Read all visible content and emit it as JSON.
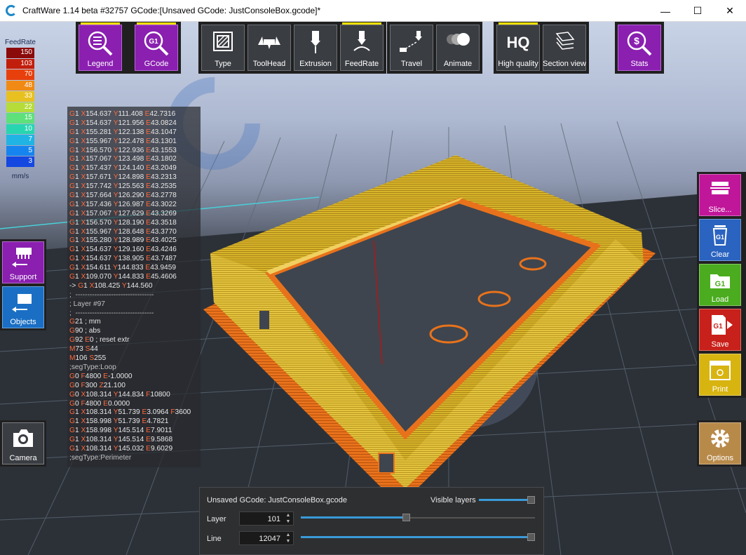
{
  "window": {
    "title": "CraftWare 1.14 beta #32757   GCode:[Unsaved GCode: JustConsoleBox.gcode]*",
    "minimize": "—",
    "maximize": "☐",
    "close": "✕"
  },
  "toolbar": {
    "legend": "Legend",
    "gcode": "GCode",
    "gcode_icon_text": "G1",
    "type": "Type",
    "toolhead": "ToolHead",
    "extrusion": "Extrusion",
    "feedrate": "FeedRate",
    "travel": "Travel",
    "animate": "Animate",
    "high_quality": "High quality",
    "hq_icon_text": "HQ",
    "section_view": "Section view",
    "stats": "Stats"
  },
  "legend": {
    "title": "FeedRate",
    "unit": "mm/s",
    "rows": [
      {
        "value": "150",
        "color": "#8b0a0a"
      },
      {
        "value": "103",
        "color": "#c21e0c"
      },
      {
        "value": "70",
        "color": "#e8400c"
      },
      {
        "value": "48",
        "color": "#f08a14"
      },
      {
        "value": "33",
        "color": "#e8c020"
      },
      {
        "value": "22",
        "color": "#b6dc3a"
      },
      {
        "value": "15",
        "color": "#5ee07a"
      },
      {
        "value": "10",
        "color": "#27d6b0"
      },
      {
        "value": "7",
        "color": "#1fb4e4"
      },
      {
        "value": "5",
        "color": "#1684ee"
      },
      {
        "value": "3",
        "color": "#1448e0"
      }
    ]
  },
  "gcode_lines": [
    "G1 X154.637 Y111.408 E42.7316",
    "G1 X154.637 Y121.956 E43.0824",
    "G1 X155.281 Y122.138 E43.1047",
    "G1 X155.967 Y122.478 E43.1301",
    "G1 X156.570 Y122.936 E43.1553",
    "G1 X157.067 Y123.498 E43.1802",
    "G1 X157.437 Y124.140 E43.2049",
    "G1 X157.671 Y124.898 E43.2313",
    "G1 X157.742 Y125.563 E43.2535",
    "G1 X157.664 Y126.290 E43.2778",
    "G1 X157.436 Y126.987 E43.3022",
    "G1 X157.067 Y127.629 E43.3269",
    "G1 X156.570 Y128.190 E43.3518",
    "G1 X155.967 Y128.648 E43.3770",
    "G1 X155.280 Y128.989 E43.4025",
    "G1 X154.637 Y129.160 E43.4246",
    "G1 X154.637 Y138.905 E43.7487",
    "G1 X154.611 Y144.833 E43.9459",
    "G1 X109.070 Y144.833 E45.4606",
    "-> G1 X108.425 Y144.560",
    ";  ---------------------------------",
    "; Layer #97",
    ";  ---------------------------------",
    "G21 ; mm",
    "G90 ; abs",
    "G92 E0 ; reset extr",
    "M73 S44",
    "M106 S255",
    ";segType:Loop",
    "G0 F4800 E-1.0000",
    "G0 F300 Z21.100",
    "G0 X108.314 Y144.834 F10800",
    "G0 F4800 E0.0000",
    "G1 X108.314 Y51.739 E3.0964 F3600",
    "G1 X158.998 Y51.739 E4.7821",
    "G1 X158.998 Y145.514 E7.9011",
    "G1 X108.314 Y145.514 E9.5868",
    "G1 X108.314 Y145.032 E9.6029",
    ";segType:Perimeter"
  ],
  "left_buttons": {
    "support": "Support",
    "objects": "Objects",
    "camera": "Camera"
  },
  "right_buttons": {
    "slice": "Slice...",
    "clear": "Clear",
    "load": "Load",
    "save": "Save",
    "print": "Print",
    "options": "Options",
    "g1_icon_text": "G1"
  },
  "bottom_panel": {
    "file_label": "Unsaved GCode: JustConsoleBox.gcode",
    "visible_layers_label": "Visible layers",
    "layer_label": "Layer",
    "layer_value": "101",
    "line_label": "Line",
    "line_value": "12047",
    "visible_layers_fraction": 1.0,
    "layer_fraction": 0.45,
    "line_fraction": 1.0
  }
}
